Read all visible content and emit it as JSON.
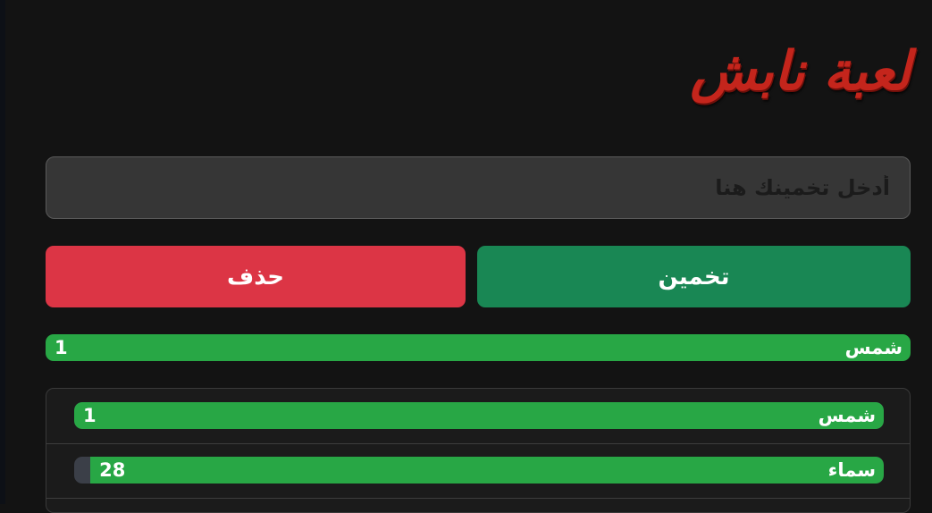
{
  "game": {
    "title": "لعبة نابش",
    "input": {
      "placeholder": "أدخل تخمينك هنا",
      "value": ""
    },
    "buttons": {
      "guess_label": "تخمين",
      "delete_label": "حذف"
    },
    "latest_guess": {
      "word": "شمس",
      "rank": "1",
      "fill_fraction": 1.0
    },
    "history": [
      {
        "word": "شمس",
        "rank": "1",
        "fill_fraction": 1.0
      },
      {
        "word": "سماء",
        "rank": "28",
        "fill_fraction": 0.98
      }
    ]
  },
  "colors": {
    "background": "#131313",
    "title": "#c4251c",
    "input_bg": "#363636",
    "guess_button": "#198754",
    "delete_button": "#dc3545",
    "bar_fill": "#28a745",
    "bar_track": "#3b3f48"
  }
}
